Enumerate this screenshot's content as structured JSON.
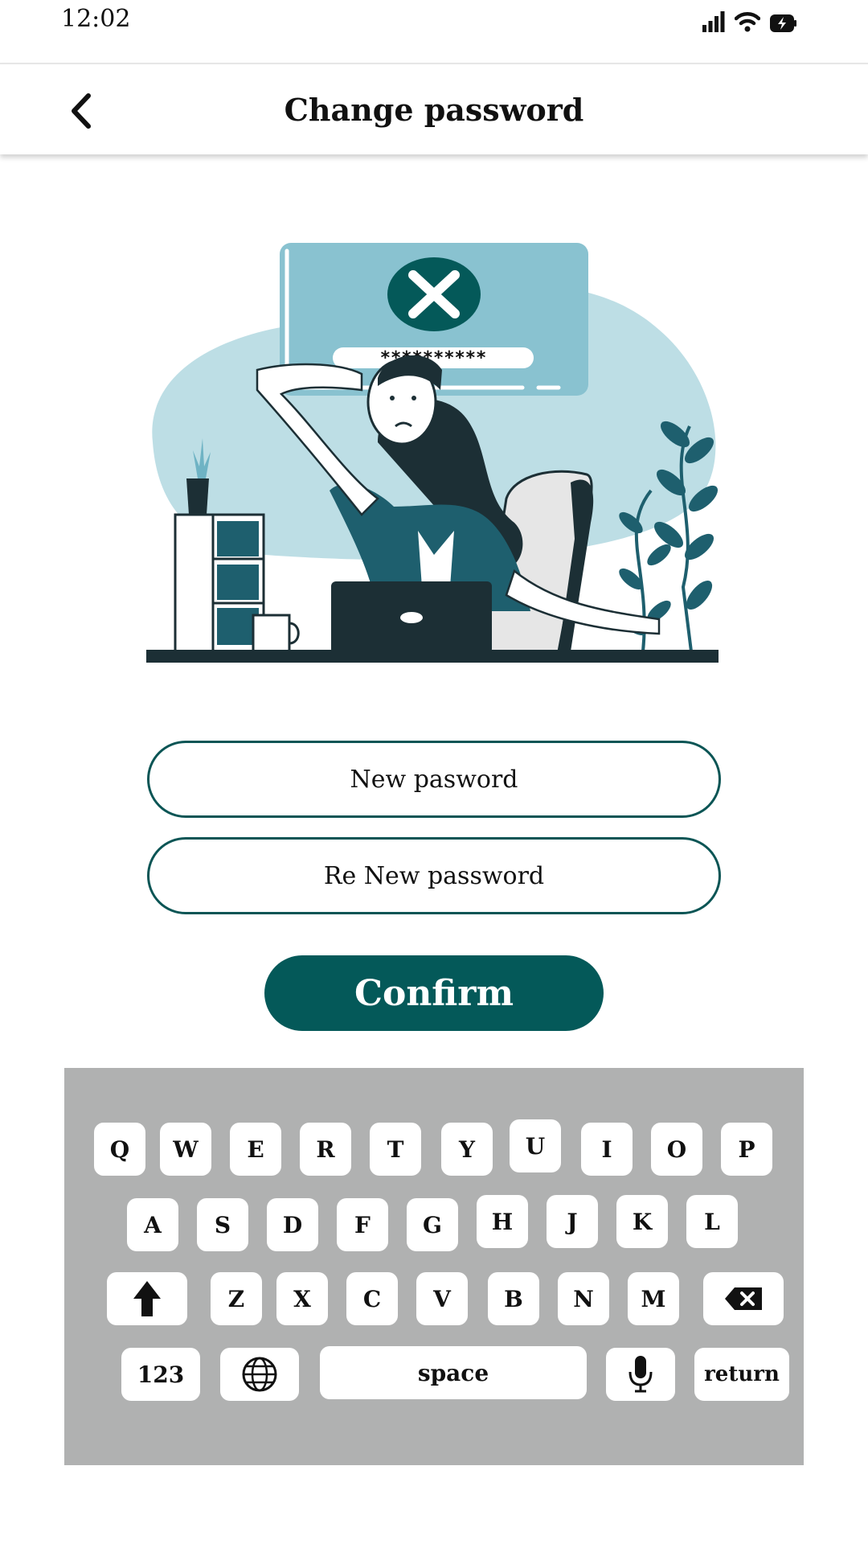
{
  "status_bar": {
    "time": "12:02"
  },
  "header": {
    "title": "Change password",
    "back_icon": "chevron-left-icon"
  },
  "illustration": {
    "alert_icon": "close-x-icon",
    "masked_password": "**********",
    "colors": {
      "primary": "#1e5f6e",
      "light": "#bddee5",
      "card": "#89c2d0",
      "dark": "#1c2f35"
    }
  },
  "form": {
    "new_password_placeholder": "New pasword",
    "re_new_password_placeholder": "Re New password",
    "confirm_label": "Confirm"
  },
  "keyboard": {
    "row1": [
      "Q",
      "W",
      "E",
      "R",
      "T",
      "Y",
      "U",
      "I",
      "O",
      "P"
    ],
    "row2": [
      "A",
      "S",
      "D",
      "F",
      "G",
      "H",
      "J",
      "K",
      "L"
    ],
    "row3": [
      "Z",
      "X",
      "C",
      "V",
      "B",
      "N",
      "M"
    ],
    "numbers_label": "123",
    "space_label": "space",
    "return_label": "return",
    "shift_icon": "shift-arrow-icon",
    "backspace_icon": "backspace-icon",
    "globe_icon": "globe-icon",
    "mic_icon": "microphone-icon"
  },
  "colors": {
    "accent": "#045959",
    "keyboard_bg": "#b0b1b1",
    "key_bg": "#ffffff"
  }
}
